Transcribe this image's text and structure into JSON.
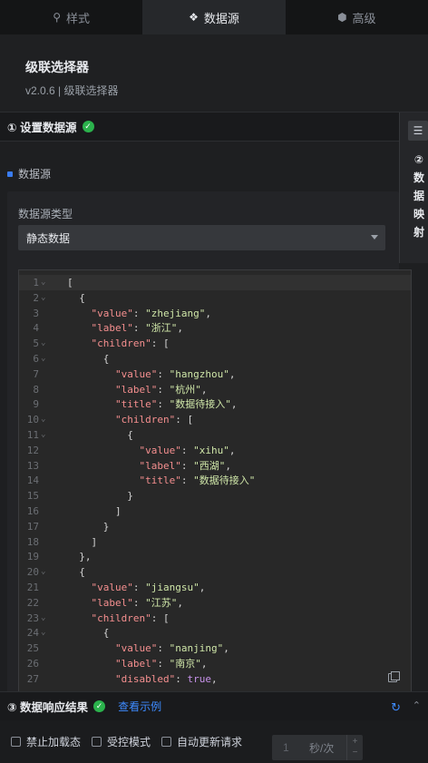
{
  "tabs": [
    {
      "label": "样式",
      "icon": "style-icon"
    },
    {
      "label": "数据源",
      "icon": "datasource-icon"
    },
    {
      "label": "高级",
      "icon": "advanced-icon"
    }
  ],
  "component": {
    "title": "级联选择器",
    "version": "v2.0.6 | 级联选择器"
  },
  "section1": {
    "title": "① 设置数据源"
  },
  "datasource": {
    "label": "数据源",
    "type_label": "数据源类型",
    "type_value": "静态数据"
  },
  "side_panel": {
    "title": "② 数据映射",
    "chars": [
      "②",
      "数",
      "据",
      "映",
      "射"
    ]
  },
  "code_lines": [
    "[",
    "  {",
    "    \"value\": \"zhejiang\",",
    "    \"label\": \"浙江\",",
    "    \"children\": [",
    "      {",
    "        \"value\": \"hangzhou\",",
    "        \"label\": \"杭州\",",
    "        \"title\": \"数据待接入\",",
    "        \"children\": [",
    "          {",
    "            \"value\": \"xihu\",",
    "            \"label\": \"西湖\",",
    "            \"title\": \"数据待接入\"",
    "          }",
    "        ]",
    "      }",
    "    ]",
    "  },",
    "  {",
    "    \"value\": \"jiangsu\",",
    "    \"label\": \"江苏\",",
    "    \"children\": [",
    "      {",
    "        \"value\": \"nanjing\",",
    "        \"label\": \"南京\",",
    "        \"disabled\": true,"
  ],
  "fold_lines": [
    1,
    2,
    5,
    6,
    10,
    11,
    20,
    23,
    24
  ],
  "section3": {
    "title": "③ 数据响应结果",
    "link": "查看示例"
  },
  "options": {
    "disable_loading": "禁止加载态",
    "controlled_mode": "受控模式",
    "auto_update": "自动更新请求",
    "interval_value": "1",
    "interval_unit": "秒/次"
  },
  "colors": {
    "accent": "#3e8bff",
    "success": "#2bb24c",
    "key": "#f58f8f",
    "string": "#cfe6a8"
  }
}
